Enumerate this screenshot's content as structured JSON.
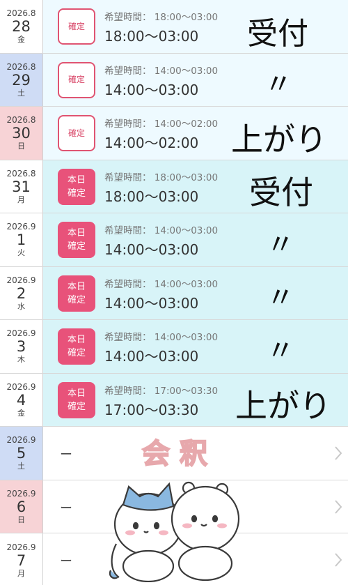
{
  "rows": [
    {
      "ym": "2026.8",
      "day": "28",
      "wd": "金",
      "badge": [
        "確定"
      ],
      "hope": "希望時間： 18:00〜03:00",
      "actual": "18:00〜03:00"
    },
    {
      "ym": "2026.8",
      "day": "29",
      "wd": "土",
      "badge": [
        "確定"
      ],
      "hope": "希望時間： 14:00〜03:00",
      "actual": "14:00〜03:00"
    },
    {
      "ym": "2026.8",
      "day": "30",
      "wd": "日",
      "badge": [
        "確定"
      ],
      "hope": "希望時間： 14:00〜02:00",
      "actual": "14:00〜02:00"
    },
    {
      "ym": "2026.8",
      "day": "31",
      "wd": "月",
      "badge": [
        "本日",
        "確定"
      ],
      "hope": "希望時間： 18:00〜03:00",
      "actual": "18:00〜03:00"
    },
    {
      "ym": "2026.9",
      "day": "1",
      "wd": "火",
      "badge": [
        "本日",
        "確定"
      ],
      "hope": "希望時間： 14:00〜03:00",
      "actual": "14:00〜03:00"
    },
    {
      "ym": "2026.9",
      "day": "2",
      "wd": "水",
      "badge": [
        "本日",
        "確定"
      ],
      "hope": "希望時間： 14:00〜03:00",
      "actual": "14:00〜03:00"
    },
    {
      "ym": "2026.9",
      "day": "3",
      "wd": "木",
      "badge": [
        "本日",
        "確定"
      ],
      "hope": "希望時間： 14:00〜03:00",
      "actual": "14:00〜03:00"
    },
    {
      "ym": "2026.9",
      "day": "4",
      "wd": "金",
      "badge": [
        "本日",
        "確定"
      ],
      "hope": "希望時間： 17:00〜03:30",
      "actual": "17:00〜03:30"
    },
    {
      "ym": "2026.9",
      "day": "5",
      "wd": "土",
      "dash": "ー"
    },
    {
      "ym": "2026.9",
      "day": "6",
      "wd": "日",
      "dash": "ー"
    },
    {
      "ym": "2026.9",
      "day": "7",
      "wd": "月",
      "dash": "ー"
    }
  ],
  "handwriting": {
    "r0": "受付",
    "r1": "〃",
    "r2": "上がり",
    "r3": "受付",
    "r4": "〃",
    "r5": "〃",
    "r6": "〃",
    "r7": "上がり"
  },
  "stamp_text": "会 釈",
  "colors": {
    "badge_pink": "#e8527a",
    "sat_bg": "#cfdcf5",
    "sun_bg": "#f7d3d6",
    "today_bg": "#d8f4f8"
  },
  "icons": [
    "chevron-right-icon",
    "character-sticker"
  ]
}
